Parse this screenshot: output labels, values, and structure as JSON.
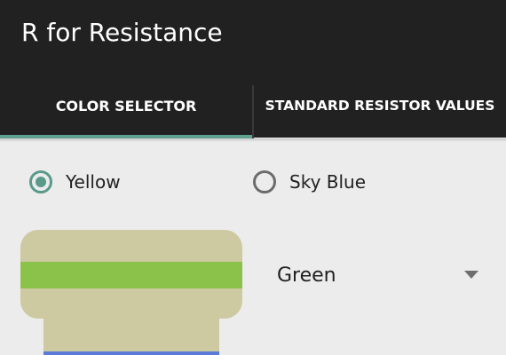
{
  "app_bar": {
    "title": "R for Resistance"
  },
  "tabs": [
    {
      "label": "COLOR SELECTOR",
      "selected": true
    },
    {
      "label": "STANDARD RESISTOR VALUES",
      "selected": false
    }
  ],
  "radio_options": [
    {
      "label": "Yellow",
      "checked": true
    },
    {
      "label": "Sky Blue",
      "checked": false
    }
  ],
  "band_spinner": {
    "value": "Green",
    "icon": "dropdown-triangle-icon"
  },
  "resistor": {
    "body_color": "#cdc9a0",
    "bands": [
      {
        "color_name": "Green",
        "color": "#8bc34a"
      },
      {
        "color": "#5c7bd6"
      }
    ]
  },
  "colors": {
    "app_bar": "#212121",
    "accent": "#5a9a8a",
    "background": "#ececec"
  }
}
